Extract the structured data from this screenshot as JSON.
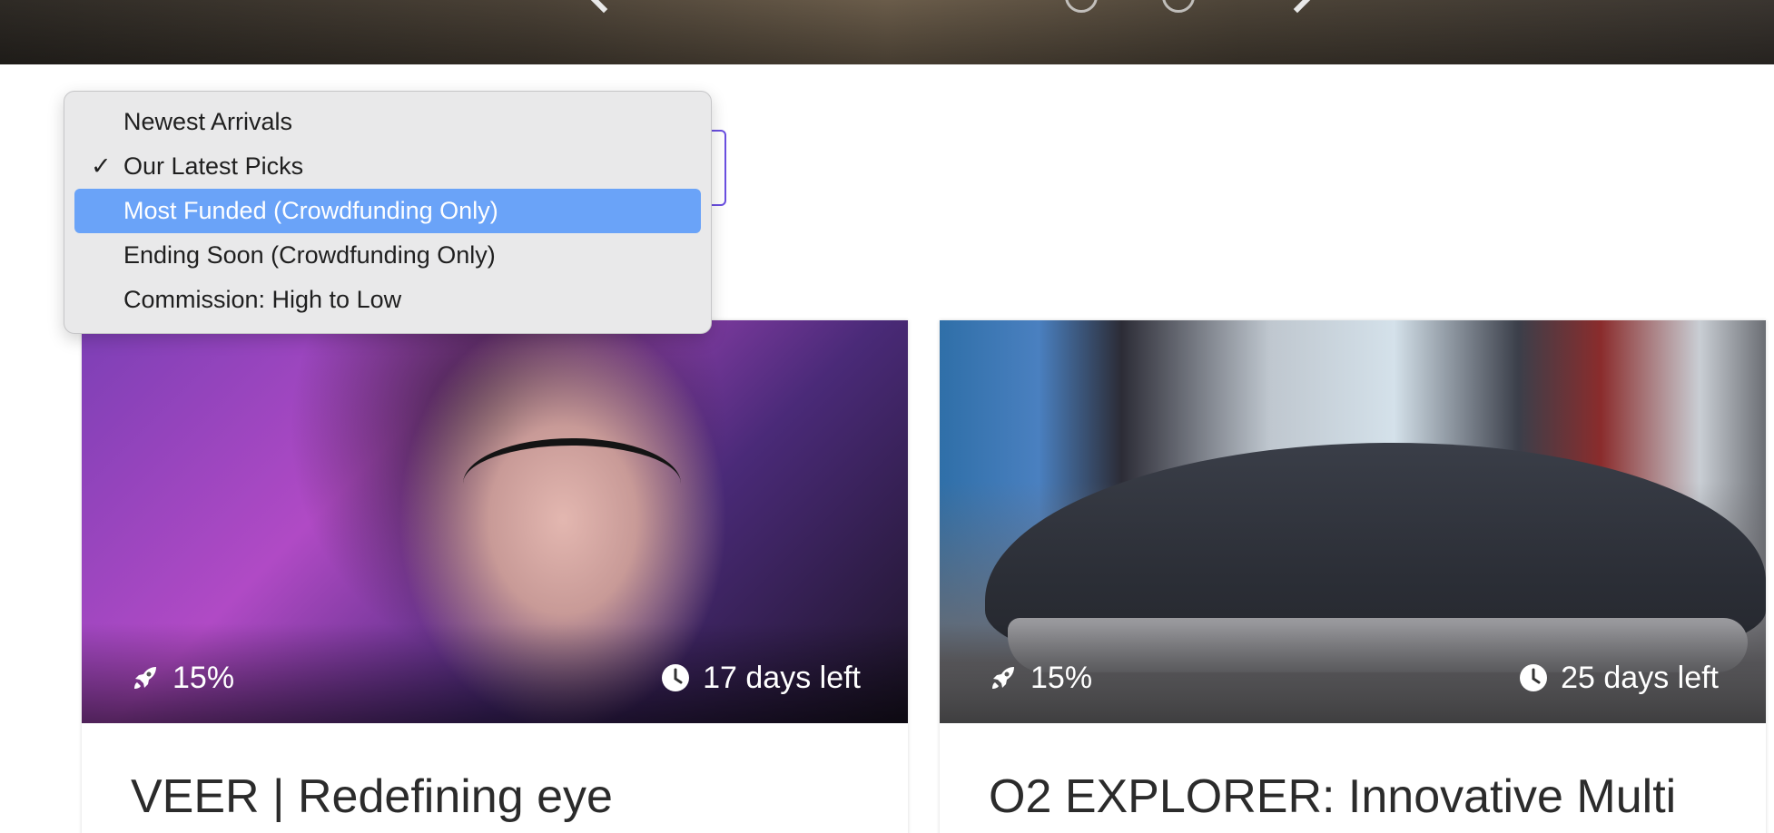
{
  "sort_menu": {
    "options": [
      {
        "label": "Newest Arrivals",
        "checked": false,
        "highlighted": false
      },
      {
        "label": "Our Latest Picks",
        "checked": true,
        "highlighted": false
      },
      {
        "label": "Most Funded (Crowdfunding Only)",
        "checked": false,
        "highlighted": true
      },
      {
        "label": "Ending Soon (Crowdfunding Only)",
        "checked": false,
        "highlighted": false
      },
      {
        "label": "Commission: High to Low",
        "checked": false,
        "highlighted": false
      }
    ],
    "check_glyph": "✓",
    "highlight_color": "#6aa3f8",
    "select_border_color": "#6a4fe0"
  },
  "hero": {
    "prev_icon": "chevron-left-icon",
    "next_icon": "chevron-right-icon"
  },
  "products": [
    {
      "title": "VEER | Redefining eye",
      "funded": "15%",
      "time_left": "17 days left",
      "funded_icon": "rocket-icon",
      "time_icon": "clock-icon"
    },
    {
      "title": "O2 EXPLORER: Innovative Multi",
      "funded": "15%",
      "time_left": "25 days left",
      "funded_icon": "rocket-icon",
      "time_icon": "clock-icon"
    }
  ]
}
